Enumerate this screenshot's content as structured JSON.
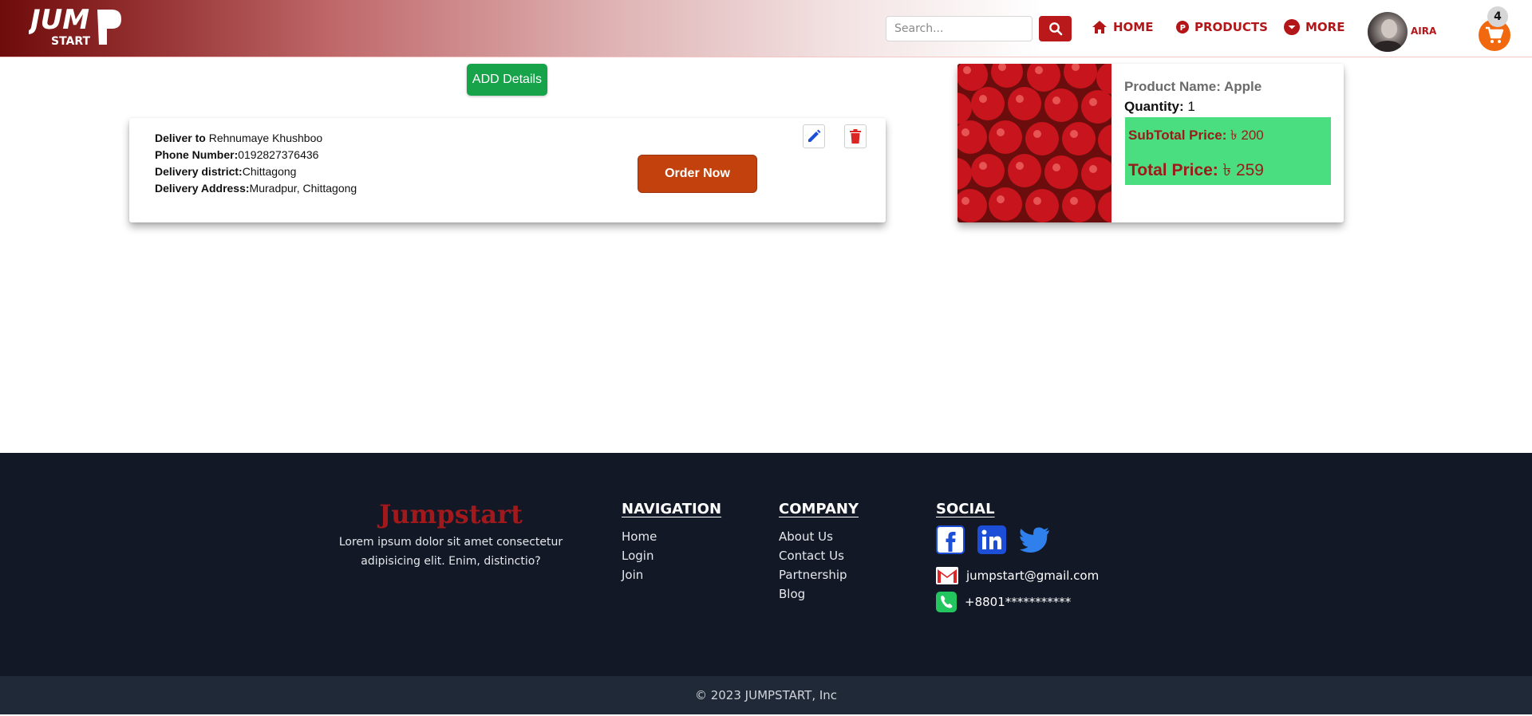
{
  "header": {
    "logo_text": "JUMP START",
    "search": {
      "placeholder": "Search...",
      "value": ""
    },
    "nav": [
      {
        "label": "HOME",
        "icon": "home-icon"
      },
      {
        "label": "PRODUCTS",
        "icon": "products-p-icon"
      },
      {
        "label": "MORE",
        "icon": "chevron-down-circle-icon"
      }
    ],
    "user": {
      "name": "AIRA"
    },
    "cart": {
      "count": "4"
    },
    "accent_color": "#b21618"
  },
  "main": {
    "add_details_label": "ADD Details",
    "address": {
      "deliver_to_label": "Deliver to",
      "deliver_to_value": "Rehnumaye Khushboo",
      "phone_label": "Phone Number:",
      "phone_value": "0192827376436",
      "district_label": "Delivery district:",
      "district_value": "Chittagong",
      "address_label": "Delivery Address:",
      "address_value": "Muradpur, Chittagong"
    },
    "order_now_label": "Order Now",
    "product": {
      "name": "Product Name: Apple",
      "quantity_label": "Quantity:",
      "quantity_value": "1",
      "subtotal_label": "SubTotal Price:",
      "subtotal_value": "৳ 200",
      "total_label": "Total Price:",
      "total_value": "৳ 259",
      "price_box_color": "#4ade80"
    }
  },
  "footer": {
    "brand_title": "Jumpstart",
    "brand_text": "Lorem ipsum dolor sit amet consectetur adipisicing elit. Enim, distinctio?",
    "navigation": {
      "title": "NAVIGATION",
      "links": [
        "Home",
        "Login",
        "Join"
      ]
    },
    "company": {
      "title": "COMPANY",
      "links": [
        "About Us",
        "Contact Us",
        "Partnership",
        "Blog"
      ]
    },
    "social": {
      "title": "SOCIAL",
      "email": "jumpstart@gmail.com",
      "phone": "+8801***********"
    },
    "copyright": "© 2023 JUMPSTART, Inc",
    "background_color": "#121826"
  }
}
